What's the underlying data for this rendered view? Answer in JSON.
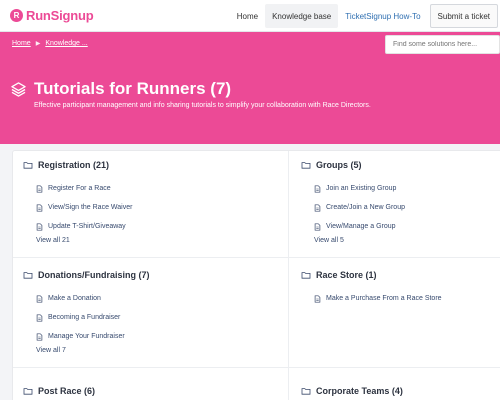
{
  "brand": {
    "name": "RunSignup",
    "mark": "R"
  },
  "nav": {
    "links": [
      {
        "label": "Home"
      },
      {
        "label": "Knowledge base"
      },
      {
        "label": "TicketSignup How-To"
      },
      {
        "label": "Submit a ticket"
      }
    ]
  },
  "breadcrumb": {
    "home": "Home",
    "current": "Knowledge ..."
  },
  "search": {
    "placeholder": "Find some solutions here..."
  },
  "hero": {
    "title": "Tutorials for Runners (7)",
    "description": "Effective participant management and info sharing tutorials to simplify your collaboration with Race Directors."
  },
  "sections": [
    {
      "title": "Registration (21)",
      "items": [
        "Register For a Race",
        "View/Sign the Race Waiver",
        "Update T-Shirt/Giveaway"
      ],
      "view_all": "View all 21"
    },
    {
      "title": "Groups (5)",
      "items": [
        "Join an Existing Group",
        "Create/Join a New Group",
        "View/Manage a Group"
      ],
      "view_all": "View all 5"
    },
    {
      "title": "Donations/Fundraising (7)",
      "items": [
        "Make a Donation",
        "Becoming a Fundraiser",
        "Manage Your Fundraiser"
      ],
      "view_all": "View all 7"
    },
    {
      "title": "Race Store (1)",
      "items": [
        "Make a Purchase From a Race Store"
      ],
      "view_all": ""
    },
    {
      "title": "Post Race (6)",
      "items": [],
      "view_all": ""
    },
    {
      "title": "Corporate Teams (4)",
      "items": [],
      "view_all": ""
    }
  ],
  "colors": {
    "brand": "#ec4a96",
    "link": "#374a6e",
    "accent_link": "#2f6fb1"
  }
}
